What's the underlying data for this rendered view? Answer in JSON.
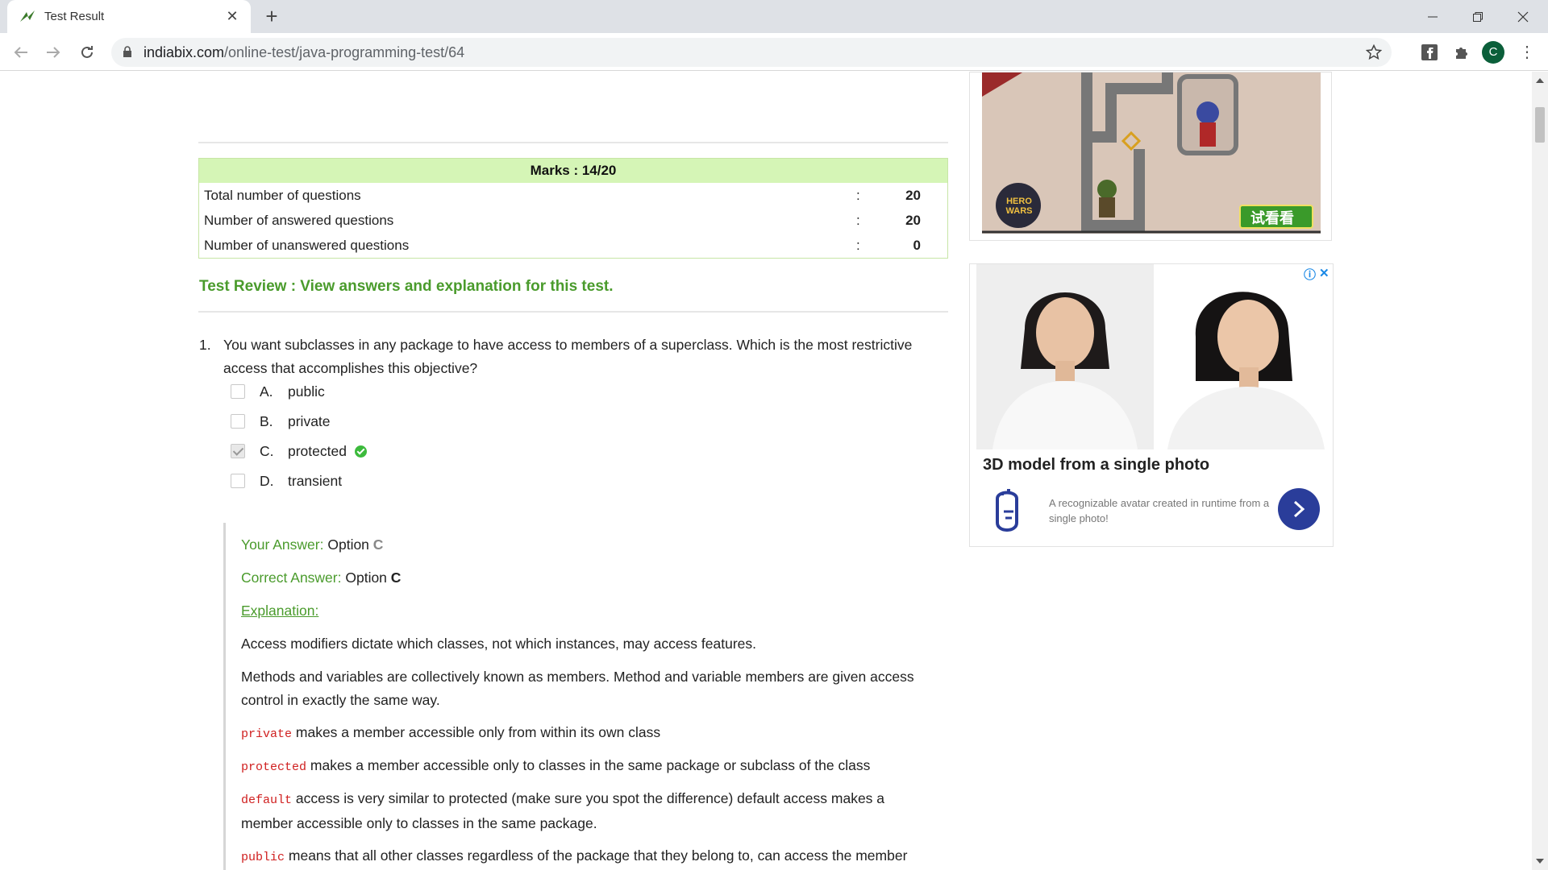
{
  "browser": {
    "tab_title": "Test Result",
    "url_host": "indiabix.com",
    "url_path": "/online-test/java-programming-test/64",
    "profile_initial": "C"
  },
  "result": {
    "marks_label": "Marks : 14/20",
    "rows": [
      {
        "label": "Total number of questions",
        "colon": ":",
        "value": "20"
      },
      {
        "label": "Number of answered questions",
        "colon": ":",
        "value": "20"
      },
      {
        "label": "Number of unanswered questions",
        "colon": ":",
        "value": "0"
      }
    ]
  },
  "review_heading": "Test Review : View answers and explanation for this test.",
  "question": {
    "number": "1.",
    "text": "You want subclasses in any package to have access to members of a superclass. Which is the most restrictive access that accomplishes this objective?",
    "options": [
      {
        "letter": "A.",
        "text": "public",
        "checked": false
      },
      {
        "letter": "B.",
        "text": "private",
        "checked": false
      },
      {
        "letter": "C.",
        "text": "protected",
        "checked": true
      },
      {
        "letter": "D.",
        "text": "transient",
        "checked": false
      }
    ]
  },
  "answer": {
    "your_label": "Your Answer:",
    "your_value": "Option",
    "your_letter": "C",
    "correct_label": "Correct Answer:",
    "correct_value": "Option",
    "correct_letter": "C",
    "explanation_label": "Explanation:",
    "p1": "Access modifiers dictate which classes, not which instances, may access features.",
    "p2": "Methods and variables are collectively known as members. Method and variable members are given access control in exactly the same way.",
    "p3_code": "private",
    "p3_text": " makes a member accessible only from within its own class",
    "p4_code": "protected",
    "p4_text": " makes a member accessible only to classes in the same package or subclass of the class",
    "p5_code": "default",
    "p5_text": " access is very similar to protected (make sure you spot the difference) default access makes a member accessible only to classes in the same package.",
    "p6_code": "public",
    "p6_text": " means that all other classes regardless of the package that they belong to, can access the member (assuming the class itself is visible)"
  },
  "ads": {
    "game_badge": "HERO WARS",
    "game_cta": "试看看",
    "ad2_title": "3D model from a single photo",
    "ad2_desc": "A recognizable avatar created in runtime from a single photo!",
    "adchoice_info": "ⓘ",
    "adchoice_close": "✕"
  },
  "colors": {
    "accent_green": "#4a9b2c",
    "marks_bg": "#d5f5b6",
    "code_red": "#d02020",
    "ad_button": "#2a3d9a"
  }
}
